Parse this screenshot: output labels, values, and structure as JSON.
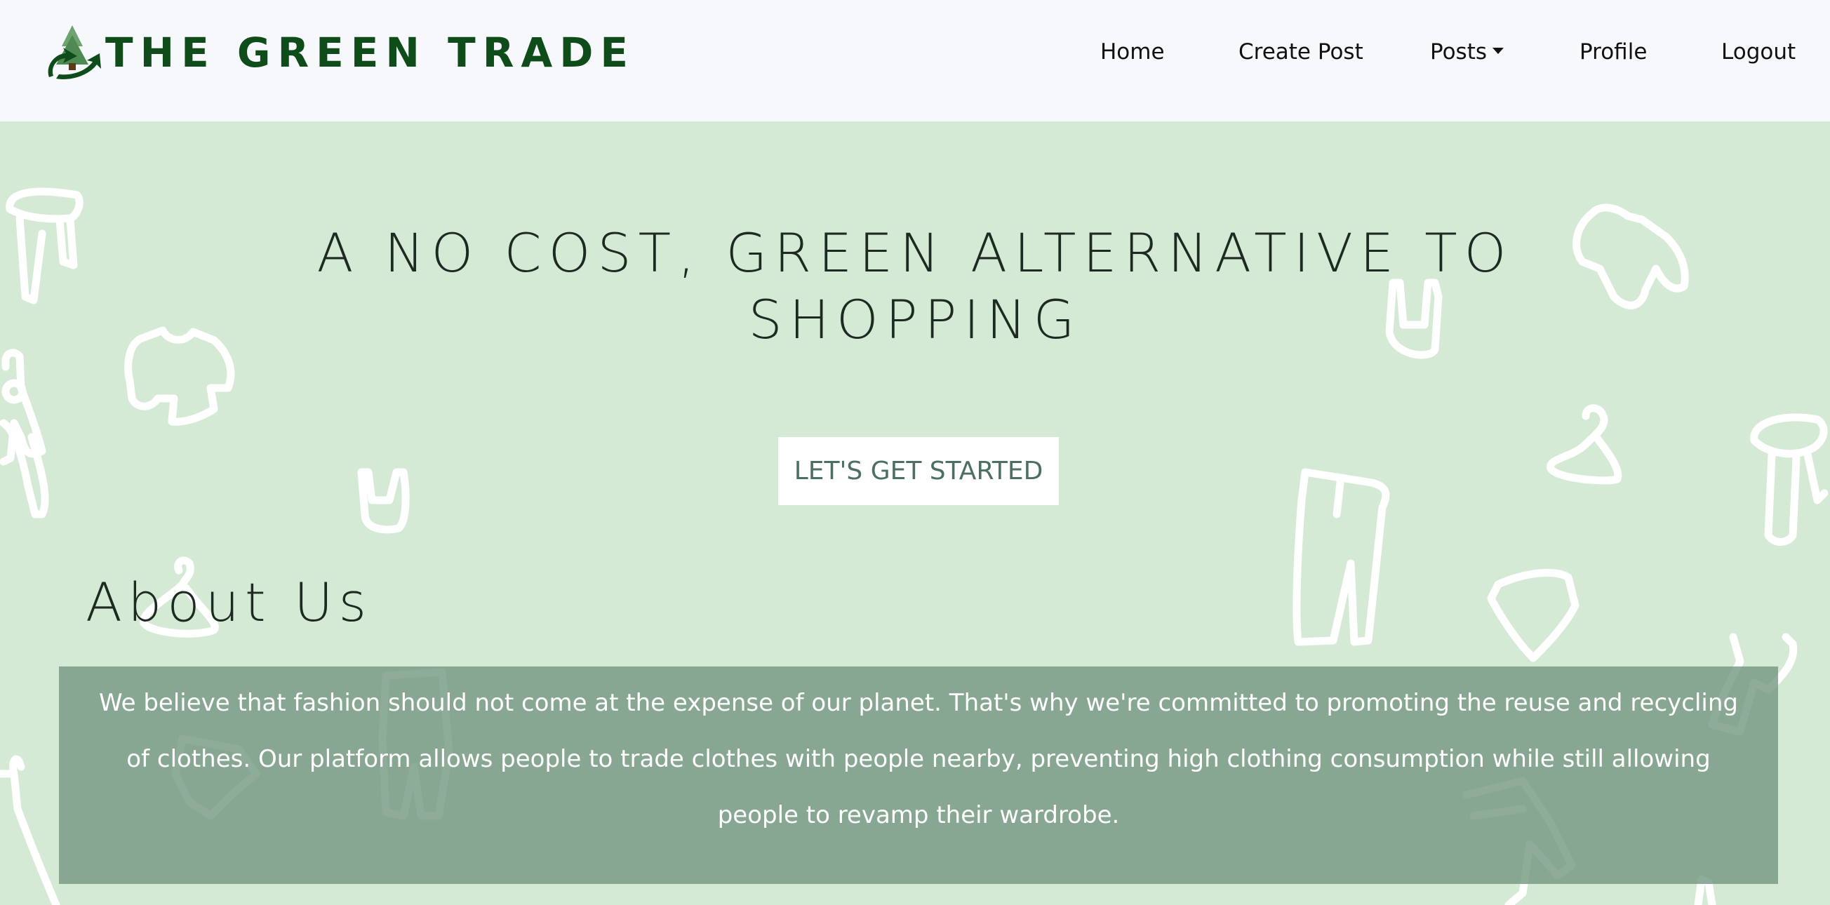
{
  "brand": {
    "name": "THE GREEN TRADE",
    "logo_icon": "tree-recycle-icon",
    "color": "#0e4d1a"
  },
  "nav": {
    "home": "Home",
    "create_post": "Create Post",
    "posts": "Posts",
    "profile": "Profile",
    "logout": "Logout"
  },
  "hero": {
    "headline": "A NO COST, GREEN ALTERNATIVE TO SHOPPING",
    "cta_label": "LET'S GET STARTED",
    "background_color": "#d5ead5"
  },
  "about": {
    "title": "About Us",
    "body": "We believe that fashion should not come at the expense of our planet. That's why we're committed to promoting the reuse and recycling of clothes. Our platform allows people to trade clothes with people nearby, preventing high clothing consumption while still allowing people to revamp their wardrobe."
  }
}
